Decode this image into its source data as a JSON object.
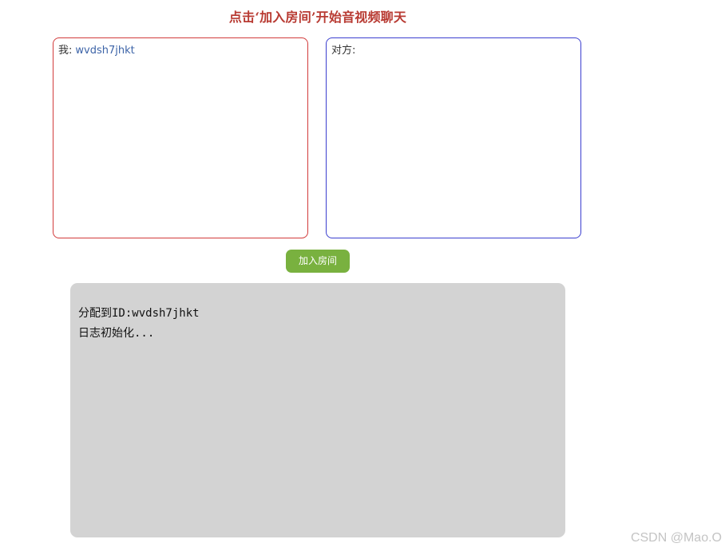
{
  "header": {
    "title": "点击‘加入房间’开始音视频聊天"
  },
  "local_video": {
    "label": "我:",
    "id": "wvdsh7jhkt"
  },
  "remote_video": {
    "label": "对方:"
  },
  "actions": {
    "join_label": "加入房间"
  },
  "log": {
    "lines": [
      "分配到ID:wvdsh7jhkt",
      "日志初始化..."
    ]
  },
  "watermark": {
    "text": "CSDN @Mao.O"
  },
  "colors": {
    "title": "#b83a32",
    "local_border": "#d23b3b",
    "remote_border": "#3b3fcf",
    "join_button": "#79b13f",
    "log_background": "#d3d3d3",
    "id_text": "#3d64a8"
  }
}
